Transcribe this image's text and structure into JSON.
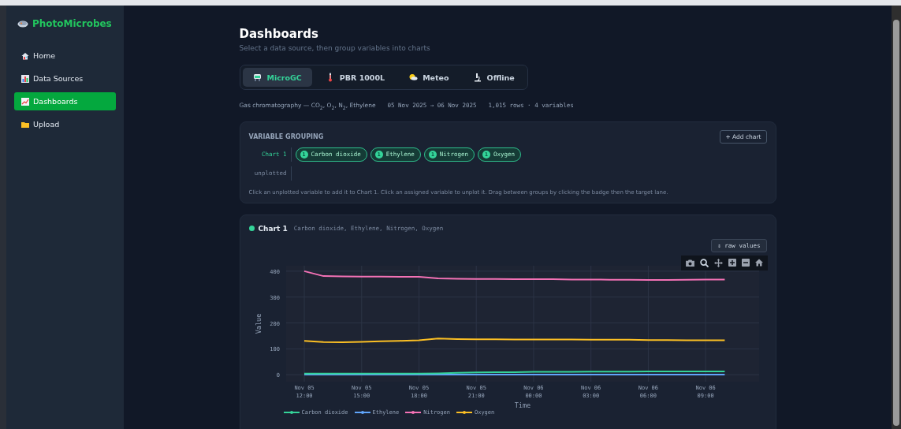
{
  "app": {
    "name": "PhotoMicrobes"
  },
  "sidebar": {
    "items": [
      {
        "label": "Home",
        "selected": false
      },
      {
        "label": "Data Sources",
        "selected": false
      },
      {
        "label": "Dashboards",
        "selected": true
      },
      {
        "label": "Upload",
        "selected": false
      }
    ]
  },
  "page": {
    "title": "Dashboards",
    "subtitle": "Select a data source, then group variables into charts"
  },
  "tabs": [
    {
      "label": "MicroGC",
      "selected": true
    },
    {
      "label": "PBR 1000L",
      "selected": false
    },
    {
      "label": "Meteo",
      "selected": false
    },
    {
      "label": "Offline",
      "selected": false
    }
  ],
  "source_info": {
    "description": "Gas chromatography — CO$_{2}$, O$_{2}$, N$_{2}$, Ethylene",
    "range": "05 Nov 2025 → 06 Nov 2025",
    "stats": "1,015 rows · 4 variables"
  },
  "grouping": {
    "title": "VARIABLE GROUPING",
    "add_button": "+ Add chart",
    "lanes": [
      {
        "label": "Chart 1",
        "kind": "chart",
        "variables": [
          {
            "badge": "1",
            "name": "Carbon dioxide"
          },
          {
            "badge": "1",
            "name": "Ethylene"
          },
          {
            "badge": "1",
            "name": "Nitrogen"
          },
          {
            "badge": "1",
            "name": "Oxygen"
          }
        ]
      },
      {
        "label": "unplotted",
        "kind": "unplotted"
      }
    ],
    "hint": "Click an unplotted variable to add it to Chart 1. Click an assigned variable to unplot it. Drag between groups by clicking the badge then the target lane."
  },
  "chart_card": {
    "title": "Chart 1",
    "variables": "Carbon dioxide, Ethylene, Nitrogen, Oxygen",
    "toggle_button": "⇕ raw values",
    "chart_data": {
      "type": "line",
      "xlabel": "Time",
      "ylabel": "Value",
      "categories": [
        "Nov 05 12:00",
        null,
        null,
        "Nov 05 15:00",
        null,
        null,
        "Nov 05 18:00",
        null,
        null,
        "Nov 05 21:00",
        null,
        null,
        "Nov 06 00:00",
        null,
        null,
        "Nov 06 03:00",
        null,
        null,
        "Nov 06 06:00",
        null,
        null,
        "Nov 06 09:00",
        null
      ],
      "series": [
        {
          "name": "Carbon dioxide",
          "color": "#34d399",
          "values": [
            4,
            4,
            4,
            4,
            4,
            4,
            4,
            5,
            7,
            9,
            10,
            10,
            11,
            11,
            11,
            12,
            12,
            12,
            13,
            13,
            13,
            13,
            13
          ]
        },
        {
          "name": "Ethylene",
          "color": "#60a5fa",
          "values": [
            0,
            0,
            0,
            0,
            0,
            0,
            0,
            0,
            0,
            0,
            0,
            0,
            0,
            0,
            0,
            0,
            0,
            0,
            0,
            0,
            0,
            0,
            0
          ]
        },
        {
          "name": "Nitrogen",
          "color": "#f472b6",
          "values": [
            400,
            381,
            380,
            379,
            379,
            378,
            378,
            372,
            371,
            370,
            370,
            369,
            369,
            369,
            368,
            368,
            367,
            367,
            366,
            366,
            367,
            368,
            368
          ]
        },
        {
          "name": "Oxygen",
          "color": "#fbbf24",
          "values": [
            131,
            126,
            125,
            127,
            129,
            131,
            133,
            140,
            138,
            137,
            137,
            136,
            136,
            136,
            136,
            135,
            135,
            135,
            134,
            134,
            133,
            133,
            133
          ]
        }
      ],
      "grid": true,
      "ylim": [
        -27,
        421
      ],
      "yticks": [
        0,
        100,
        200,
        300,
        400
      ]
    }
  }
}
